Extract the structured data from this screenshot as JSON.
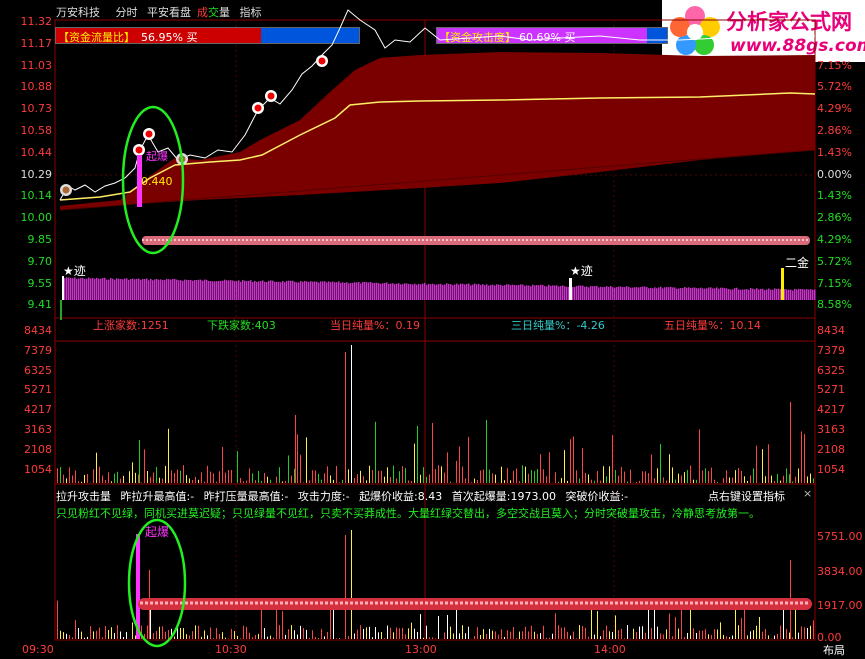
{
  "header": {
    "stock_name": "万安科技",
    "menu": [
      "分时",
      "平安看盘",
      "成",
      "交",
      "量",
      "指标"
    ]
  },
  "capital_flow": {
    "left_label": "【资金流量比】",
    "left_value": "56.95% 买",
    "right_label": "【资金攻击度】",
    "right_value": "60.69% 买"
  },
  "watermark": {
    "title": "分析家公式网",
    "url": "www.88gs.com"
  },
  "price_axis_left": [
    "11.32",
    "11.17",
    "11.03",
    "10.88",
    "10.73",
    "10.58",
    "10.44",
    "10.29",
    "10.14",
    "10.00",
    "9.85",
    "9.70",
    "9.55",
    "9.41"
  ],
  "price_axis_right": [
    "",
    "",
    "7.15%",
    "5.72%",
    "4.29%",
    "2.86%",
    "1.43%",
    "0.00%",
    "1.43%",
    "2.86%",
    "4.29%",
    "5.72%",
    "7.15%",
    "8.58%"
  ],
  "price_annotations": {
    "burst": "起爆",
    "value": "0.440",
    "trace1": "★迹",
    "trace2": "★迹",
    "second_gold": "二金"
  },
  "stats": {
    "up_count": "上涨家数:1251",
    "down_count": "下跌家数:403",
    "day_net": "当日纯量%：0.19",
    "three_day_net": "三日纯量%：-4.26",
    "five_day_net": "五日纯量%：10.14"
  },
  "volume_axis_left": [
    "8434",
    "7379",
    "6325",
    "5271",
    "4217",
    "3163",
    "2108",
    "1054"
  ],
  "volume_axis_right": [
    "8434",
    "7379",
    "6325",
    "5271",
    "4217",
    "3163",
    "2108",
    "1054"
  ],
  "indicator": {
    "header_items": [
      "拉升攻击量",
      "昨拉升最高值:-",
      "昨打压量最高值:-",
      "攻击力度:-",
      "起爆价收益:8.43",
      "首次起爆量:1973.00",
      "突破价收益:-"
    ],
    "settings_hint": "点右键设置指标",
    "close": "×",
    "notice": "只见粉红不见绿，同机买进莫迟疑；只见绿量不见红，只卖不买莽成性。大量红绿交替出，多空交战且莫入；分时突破量攻击，冷静思考放第一。",
    "burst": "起爆",
    "axis_right": [
      "5751.00",
      "3834.00",
      "1917.00",
      "0.00"
    ]
  },
  "time_axis": [
    "09:30",
    "10:30",
    "13:00",
    "14:00"
  ],
  "layout_button": "布局"
}
